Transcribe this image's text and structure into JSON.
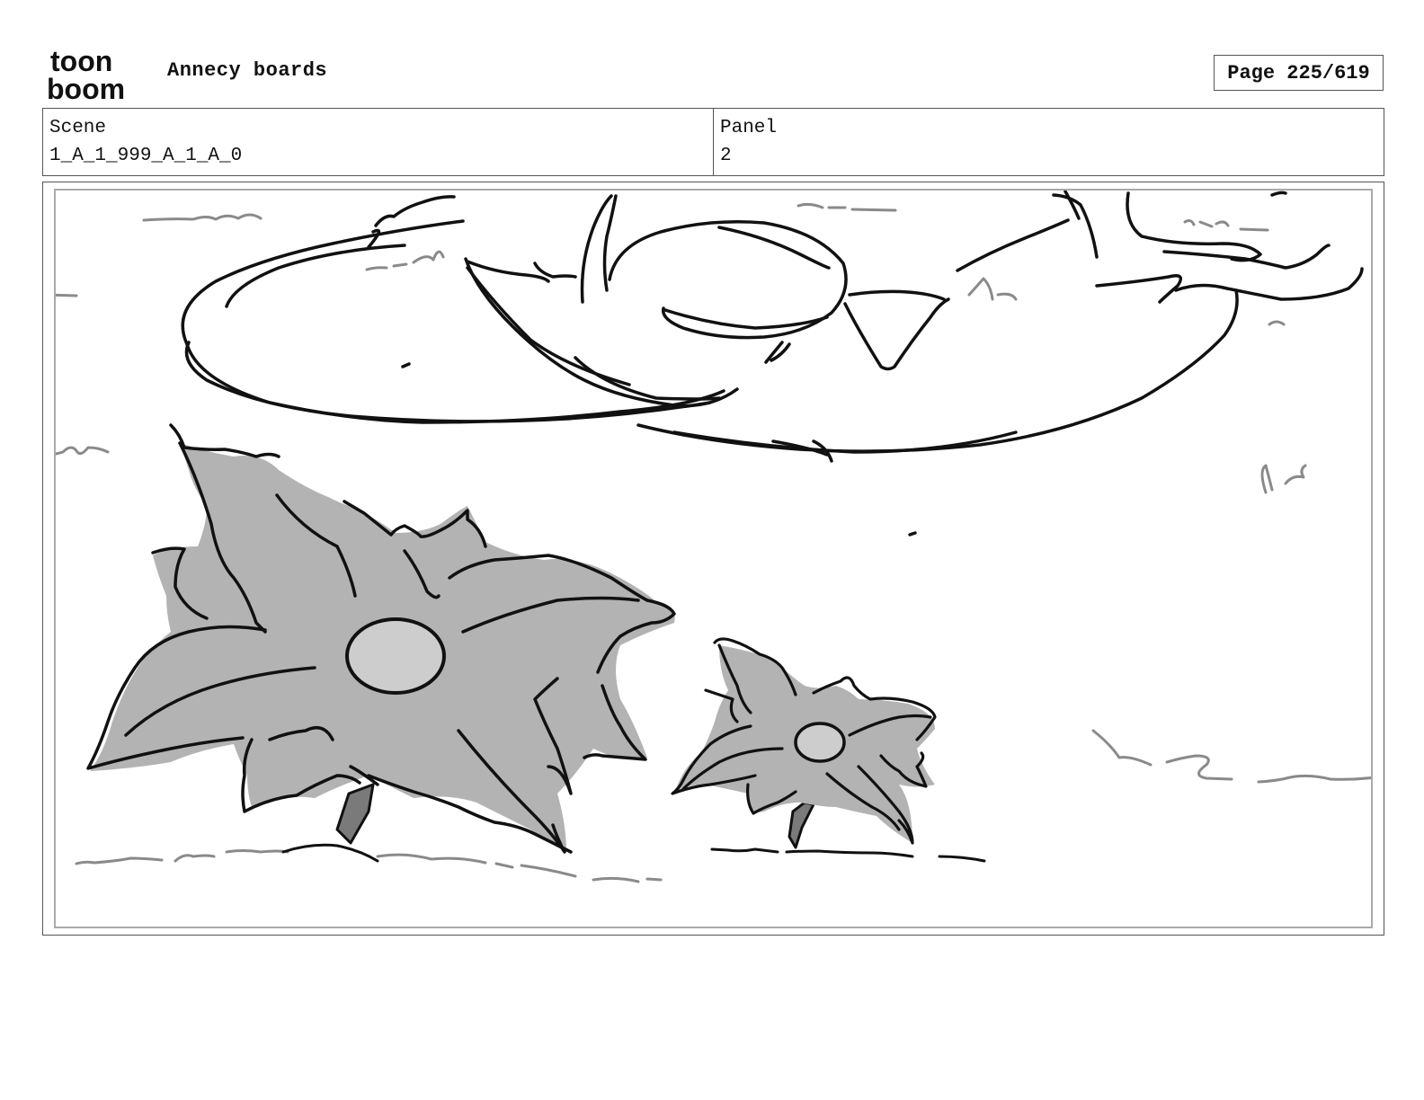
{
  "header": {
    "logo_line1": "toon",
    "logo_line2": "boom",
    "project_title": "Annecy boards",
    "page_label": "Page 225/619"
  },
  "info": {
    "scene_label": "Scene",
    "scene_value": "1_A_1_999_A_1_A_0",
    "panel_label": "Panel",
    "panel_value": "2"
  },
  "colors": {
    "ink": "#111111",
    "leaf_fill": "#b3b3b3",
    "center_fill": "#cdcdcd",
    "stem_fill": "#7a7a7a",
    "grass": "#8a8a8a"
  }
}
